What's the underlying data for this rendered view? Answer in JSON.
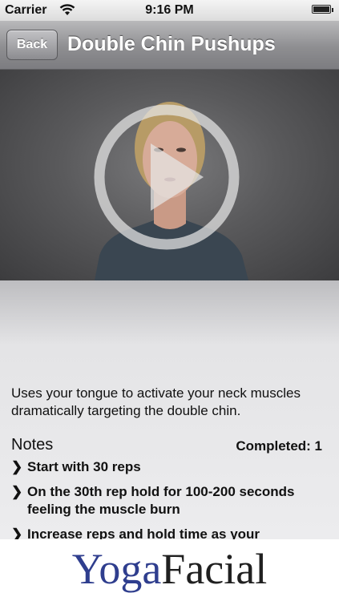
{
  "status_bar": {
    "carrier": "Carrier",
    "time": "9:16 PM"
  },
  "nav": {
    "back_label": "Back",
    "title": "Double Chin Pushups"
  },
  "video": {
    "play_icon": "play-circle-icon"
  },
  "content": {
    "description": "Uses your tongue to activate your neck muscles dramatically targeting the double chin.",
    "notes_heading": "Notes",
    "completed": "Completed: 1",
    "notes": [
      "Start with 30 reps",
      "On the 30th rep hold for 100-200 seconds feeling the muscle burn",
      "Increase reps and hold time as your"
    ]
  },
  "footer": {
    "logo_part1": "Yoga",
    "logo_part2": "Facial"
  },
  "colors": {
    "logo_blue": "#2f3e8e",
    "navbar": "#8e8e91"
  }
}
